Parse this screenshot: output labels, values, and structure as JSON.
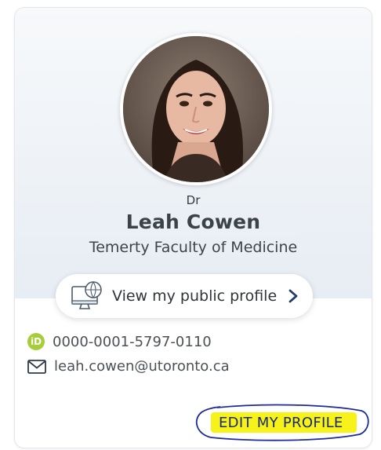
{
  "profile": {
    "prefix": "Dr",
    "name": "Leah Cowen",
    "faculty": "Temerty Faculty of Medicine",
    "avatar_alt": "profile photo"
  },
  "public_profile_button": {
    "label": "View my public profile",
    "icon": "monitor-globe-icon",
    "chevron": "chevron-right-icon"
  },
  "contact": {
    "orcid_icon_text": "iD",
    "orcid": "0000-0001-5797-0110",
    "email": "leah.cowen@utoronto.ca"
  },
  "edit_profile": {
    "label": "EDIT MY PROFILE"
  },
  "colors": {
    "orcid_green": "#a6ce39",
    "highlight_yellow": "#f6f21a",
    "annotation_blue": "#1c2a9b",
    "text_dark": "#3b4248"
  }
}
